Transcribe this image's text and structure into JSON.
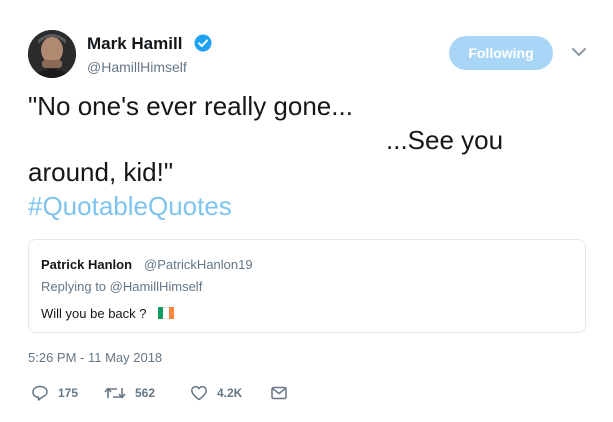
{
  "author": {
    "display_name": "Mark Hamill",
    "handle": "@HamillHimself",
    "verified": true
  },
  "follow_button": {
    "label": "Following"
  },
  "tweet": {
    "line1": "\"No one's ever really gone...",
    "line2": "...See you",
    "line3": "around, kid!\"",
    "hashtag": "#QuotableQuotes"
  },
  "quoted_tweet": {
    "name": "Patrick Hanlon",
    "handle": "@PatrickHanlon19",
    "replying_prefix": "Replying to ",
    "replying_to": "@HamillHimself",
    "text": "Will you be back ?"
  },
  "timestamp": "5:26 PM - 11 May 2018",
  "actions": {
    "replies": "175",
    "retweets": "562",
    "likes": "4.2K"
  },
  "colors": {
    "follow_bg": "#a9d6f6",
    "hashtag": "#7ec4ee",
    "secondary": "#657786",
    "verified": "#1da1f2",
    "flag": [
      "#169b62",
      "#ffffff",
      "#ff883e"
    ]
  },
  "icons": [
    "verified-badge-icon",
    "chevron-down-icon",
    "reply-icon",
    "retweet-icon",
    "like-icon",
    "message-icon"
  ]
}
